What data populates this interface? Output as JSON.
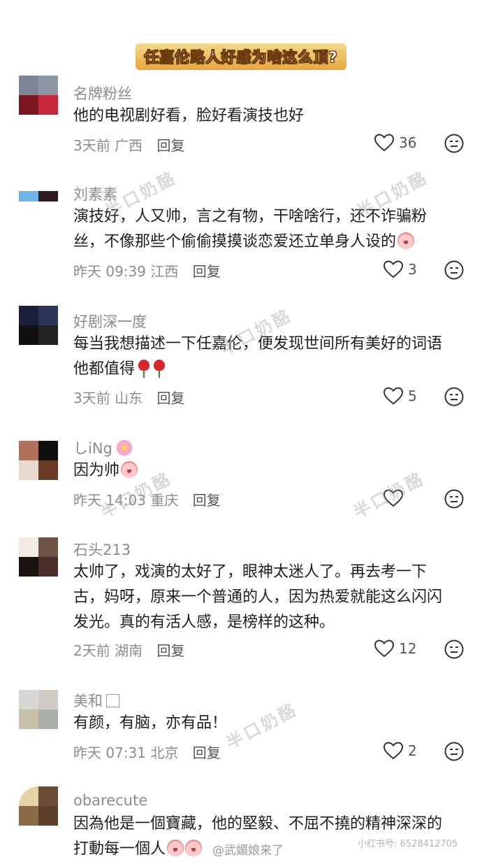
{
  "header": {
    "title": "任嘉伦路人好感为啥这么顶?"
  },
  "comments": [
    {
      "username": "名牌粉丝",
      "lines": [
        "他的电视剧好看，脸好看演技也好"
      ],
      "time": "3天前",
      "location": "广西",
      "reply": "回复",
      "likes": "36",
      "avatar_colors": [
        "#7b8593",
        "#8d96a3",
        "#7c1620",
        "#c7273a"
      ]
    },
    {
      "username": "刘素素",
      "lines": [
        "演技好，人又帅，言之有物，干啥啥行，还不诈骗粉",
        "丝，不像那些个偷偷摸摸谈恋爱还立单身人设的"
      ],
      "time": "昨天 09:39",
      "location": "江西",
      "reply": "回复",
      "likes": "3",
      "avatar_colors": [
        "#6bb6ea",
        "#2e1b1b",
        "#ffffff",
        "#ffffff"
      ]
    },
    {
      "username": "好剧深一度",
      "lines": [
        "每当我想描述一下任嘉伦，便发现世间所有美好的词语",
        "他都值得"
      ],
      "time": "3天前",
      "location": "山东",
      "reply": "回复",
      "likes": "5",
      "avatar_colors": [
        "#1b1f3b",
        "#2a3559",
        "#101010",
        "#232323"
      ]
    },
    {
      "username": "しiNg",
      "lines": [
        "因为帅"
      ],
      "time": "昨天 14:03",
      "location": "重庆",
      "reply": "回复",
      "likes": "",
      "avatar_colors": [
        "#b0705a",
        "#0f0f0f",
        "#e8d9cf",
        "#6a3b22"
      ]
    },
    {
      "username": "石头213",
      "lines": [
        "太帅了，戏演的太好了，眼神太迷人了。再去考一下",
        "古，妈呀，原来一个普通的人，因为热爱就能这么闪闪",
        "发光。真的有活人感，是榜样的这种。"
      ],
      "time": "2天前",
      "location": "湖南",
      "reply": "回复",
      "likes": "12",
      "avatar_colors": [
        "#f1ebe3",
        "#6e5446",
        "#1a1310",
        "#4a2e28"
      ]
    },
    {
      "username": "美和",
      "lines": [
        "有颜，有脑，亦有品！"
      ],
      "time": "昨天 07:31",
      "location": "北京",
      "reply": "回复",
      "likes": "2",
      "avatar_colors": [
        "#d8d6d1",
        "#cfcac4",
        "#c7c0a8",
        "#a9b0aa"
      ]
    },
    {
      "username": "obarecute",
      "lines": [
        "因為他是一個寶藏，他的堅毅、不屈不撓的精神深深的",
        "打動每一個人"
      ],
      "time": "",
      "location": "",
      "reply": "",
      "likes": "",
      "avatar_colors": [
        "#e6d3a6",
        "#6b4b33",
        "#8a6a47",
        "#5c3f28"
      ]
    }
  ],
  "watermark_text": "半口奶酪",
  "credit_small": "小红书号: 6528412705",
  "credit_weibo": "@武媚娘来了",
  "icons": {
    "like": "heart-outline-icon",
    "dislike": "meh-face-icon"
  }
}
